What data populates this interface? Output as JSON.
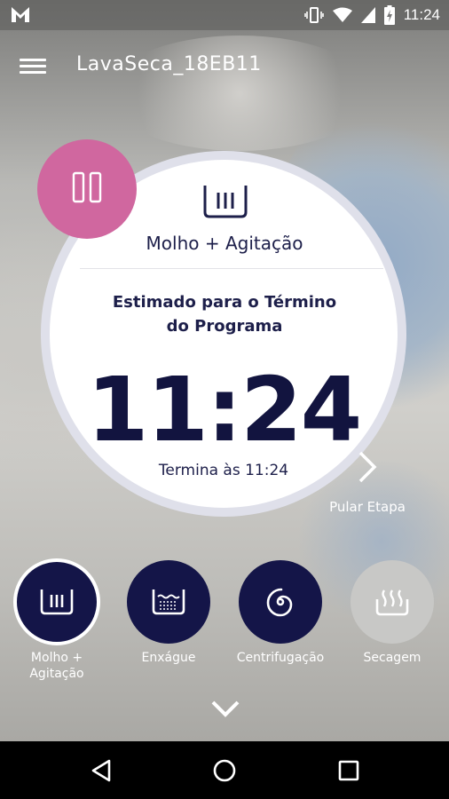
{
  "statusbar": {
    "time": "11:24",
    "left_icon": "gmail-m-icon",
    "right_icons": [
      "vibrate-icon",
      "wifi-icon",
      "signal-icon",
      "battery-charging-icon"
    ]
  },
  "appbar": {
    "title": "LavaSeca_18EB11",
    "menu_icon": "hamburger-menu-icon"
  },
  "current_step": {
    "name": "Molho + Agitação",
    "estimate_label_line1": "Estimado para o Término",
    "estimate_label_line2": "do Programa",
    "end_time": "11:24",
    "ends_at": "Termina às 11:24"
  },
  "controls": {
    "pause_icon": "pause-icon",
    "skip_label": "Pular Etapa"
  },
  "steps": [
    {
      "label_line1": "Molho +",
      "label_line2": "Agitação",
      "icon": "soak-agitate-icon",
      "state": "selected"
    },
    {
      "label_line1": "Enxágue",
      "label_line2": "",
      "icon": "rinse-icon",
      "state": "pending"
    },
    {
      "label_line1": "Centrifugação",
      "label_line2": "",
      "icon": "spin-icon",
      "state": "pending"
    },
    {
      "label_line1": "Secagem",
      "label_line2": "",
      "icon": "drying-icon",
      "state": "disabled"
    }
  ],
  "colors": {
    "accent_pink": "#d0679f",
    "navy": "#141548",
    "text_dark": "#1d1f4a",
    "disabled_gray": "#c8c8c6"
  }
}
